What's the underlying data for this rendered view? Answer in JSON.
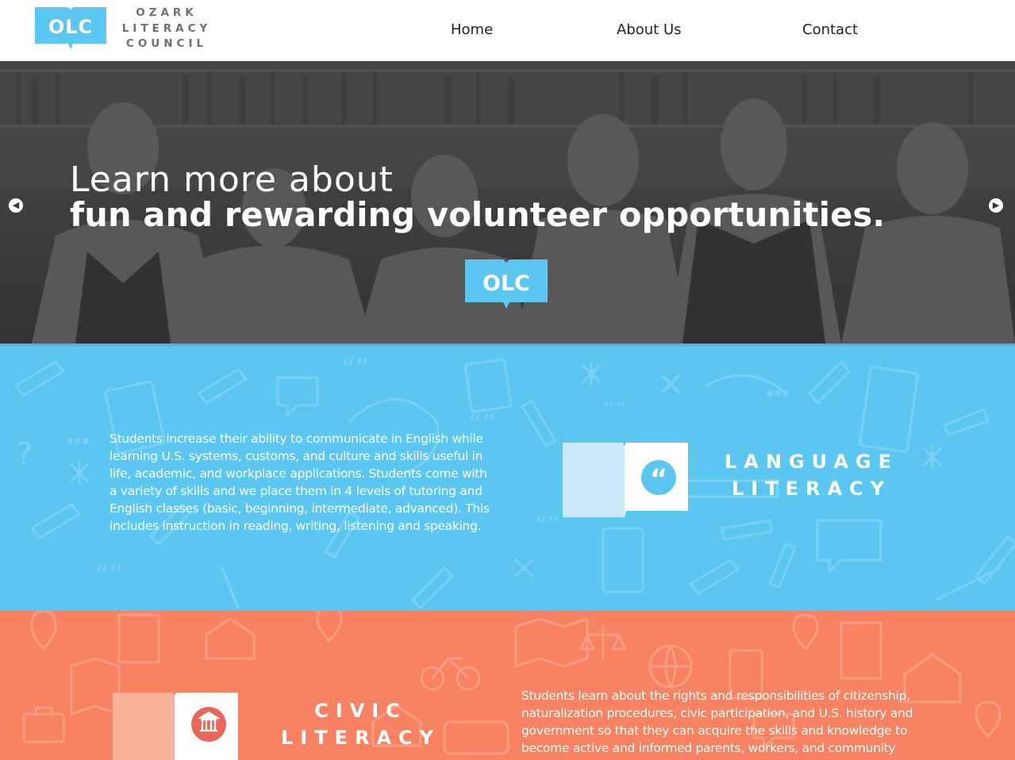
{
  "header": {
    "logo_initials": "OLC",
    "logo_lines": [
      "OZARK",
      "LITERACY",
      "COUNCIL"
    ],
    "nav": [
      {
        "label": "Home"
      },
      {
        "label": "About Us"
      },
      {
        "label": "Contact"
      }
    ]
  },
  "hero": {
    "line1": "Learn more about",
    "line2": "fun and rewarding volunteer opportunities.",
    "logo_initials": "OLC",
    "prev_icon": "arrow-left-icon",
    "next_icon": "arrow-right-icon"
  },
  "language": {
    "description": "Students increase their ability to communicate in English while learning U.S. systems, customs, and culture and skills useful in life, academic, and workplace applications. Students come with a variety of skills and we place them in 4 levels of tutoring and English classes (basic, beginning, intermediate, advanced). This includes instruction in reading, writing, listening and speaking.",
    "title_lines": [
      "LANGUAGE",
      "LITERACY"
    ],
    "icon": "quote-book-icon",
    "color": "#5bc6f0"
  },
  "civic": {
    "title_lines": [
      "CIVIC",
      "LITERACY"
    ],
    "description": "Students learn about the rights and responsibilities of citizenship, naturalization procedures, civic participation, and U.S. history and government so that they can acquire the skills and knowledge to become active and informed parents, workers, and community",
    "icon": "building-book-icon",
    "color": "#f68262"
  },
  "colors": {
    "logo_blue": "#5bc6f0",
    "logo_text_gray": "#6f6f6f",
    "civic_red": "#e9675a"
  }
}
